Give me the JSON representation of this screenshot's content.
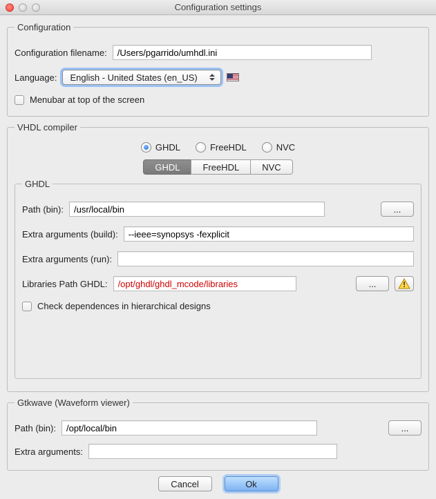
{
  "window": {
    "title": "Configuration settings"
  },
  "config": {
    "legend": "Configuration",
    "filename_label": "Configuration filename:",
    "filename_value": "/Users/pgarrido/umhdl.ini",
    "language_label": "Language:",
    "language_value": "English - United States (en_US)",
    "menubar_label": "Menubar at top of the screen"
  },
  "compiler": {
    "legend": "VHDL compiler",
    "radios": {
      "ghdl": "GHDL",
      "freehdl": "FreeHDL",
      "nvc": "NVC"
    },
    "tabs": {
      "ghdl": "GHDL",
      "freehdl": "FreeHDL",
      "nvc": "NVC"
    },
    "ghdl": {
      "legend": "GHDL",
      "path_label": "Path (bin):",
      "path_value": "/usr/local/bin",
      "browse": "...",
      "args_build_label": "Extra arguments (build):",
      "args_build_value": "--ieee=synopsys -fexplicit",
      "args_run_label": "Extra arguments (run):",
      "args_run_value": "",
      "libs_label": "Libraries Path GHDL:",
      "libs_value": "/opt/ghdl/ghdl_mcode/libraries",
      "libs_browse": "...",
      "check_deps_label": "Check dependences in hierarchical designs"
    }
  },
  "gtkwave": {
    "legend": "Gtkwave (Waveform viewer)",
    "path_label": "Path (bin):",
    "path_value": "/opt/local/bin",
    "browse": "...",
    "args_label": "Extra arguments:",
    "args_value": ""
  },
  "buttons": {
    "cancel": "Cancel",
    "ok": "Ok"
  }
}
